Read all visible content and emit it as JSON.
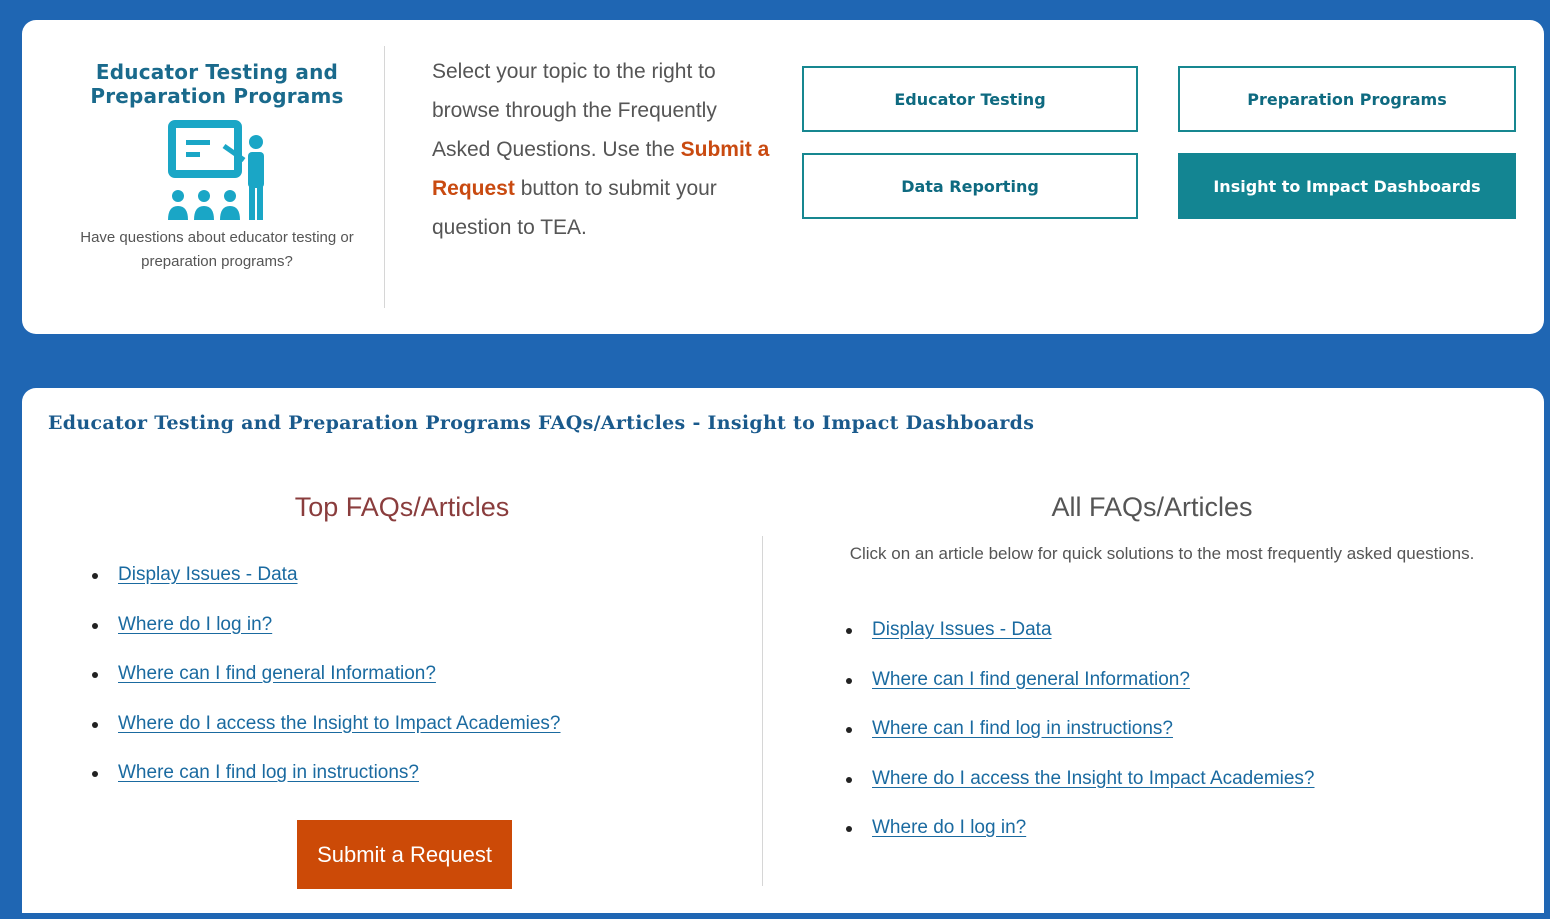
{
  "brand": {
    "title": "Educator Testing and Preparation Programs",
    "subtitle": "Have questions about educator testing or preparation programs?",
    "icon": "classroom-teacher-icon"
  },
  "intro": {
    "text_before": "Select your topic to the right to browse through the Frequently Asked Questions. Use the ",
    "highlight": "Submit a Request",
    "text_after": " button to submit your question to TEA."
  },
  "topics": [
    {
      "label": "Educator Testing",
      "active": false
    },
    {
      "label": "Preparation Programs",
      "active": false
    },
    {
      "label": "Data Reporting",
      "active": false
    },
    {
      "label": "Insight to Impact Dashboards",
      "active": true
    }
  ],
  "section": {
    "title": "Educator Testing and Preparation Programs FAQs/Articles - Insight to Impact Dashboards"
  },
  "top_faqs": {
    "heading": "Top FAQs/Articles",
    "items": [
      "Display Issues - Data",
      "Where do I log in?",
      "Where can I find general Information?",
      "Where do I access the Insight to Impact Academies?",
      "Where can I find log in instructions?"
    ],
    "submit_label": "Submit a Request"
  },
  "all_faqs": {
    "heading": "All FAQs/Articles",
    "description": "Click on an article below for quick solutions to the most frequently asked questions.",
    "items": [
      "Display Issues - Data",
      "Where can I find general Information?",
      "Where can I find log in instructions?",
      "Where do I access the Insight to Impact Academies?",
      "Where do I log in?"
    ]
  },
  "colors": {
    "background": "#1f66b3",
    "accent": "#138592",
    "submit": "#cc4a07",
    "link": "#1a6aa0"
  }
}
